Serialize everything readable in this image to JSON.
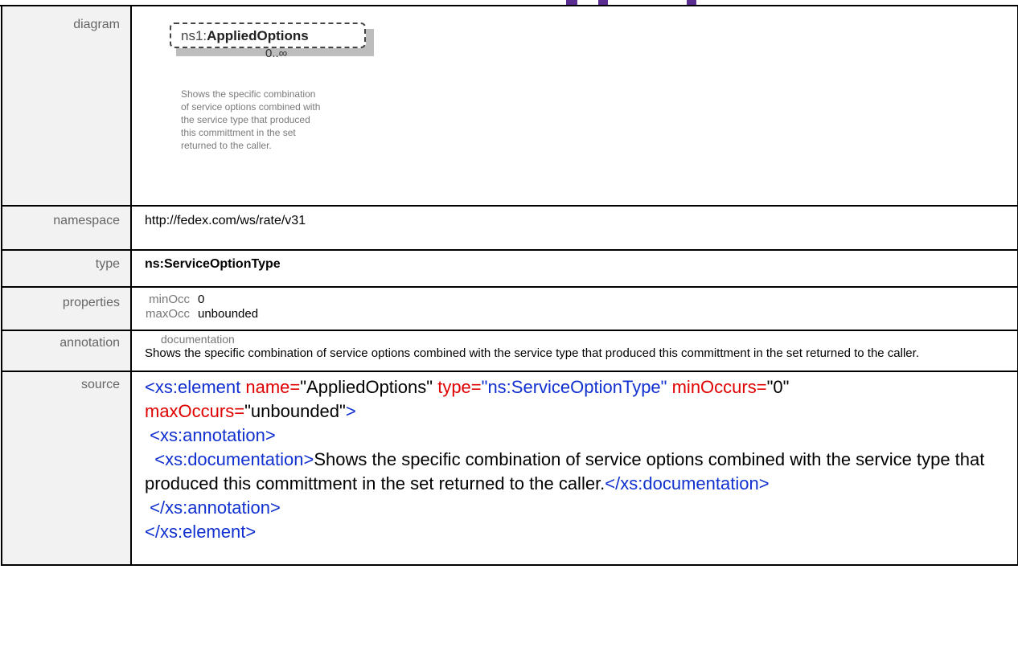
{
  "labels": {
    "diagram": "diagram",
    "namespace": "namespace",
    "type": "type",
    "properties": "properties",
    "annotation": "annotation",
    "source": "source"
  },
  "diagram": {
    "prefix": "ns1:",
    "element_name": "AppliedOptions",
    "occurrence": "0..∞",
    "note": "Shows the specific combination of service options combined with the service type that produced this committment in the set returned to the caller."
  },
  "namespace": "http://fedex.com/ws/rate/v31",
  "type": "ns:ServiceOptionType",
  "properties": [
    {
      "key": "minOcc",
      "value": "0"
    },
    {
      "key": "maxOcc",
      "value": "unbounded"
    }
  ],
  "annotation": {
    "key": "documentation",
    "text": "Shows the specific combination of service options combined with the service type that produced this committment in the set returned to the caller."
  },
  "source": {
    "open_tag": "<xs:element",
    "attr1_name": "name=",
    "attr1_value": "\"AppliedOptions\"",
    "attr2_name": "type=",
    "attr2_value": "\"ns:ServiceOptionType\"",
    "attr3_name": "minOccurs=",
    "attr3_value": "\"0\"",
    "attr4_name": "maxOccurs=",
    "attr4_value": "\"unbounded\"",
    "close_bracket": ">",
    "annotation_open": "<xs:annotation>",
    "documentation_open": "<xs:documentation>",
    "documentation_text": "Shows the specific combination of service options combined with the service type that produced this committment in the set returned to the caller.",
    "documentation_close": "</xs:documentation>",
    "annotation_close": "</xs:annotation>",
    "element_close": "</xs:element>"
  },
  "colors": {
    "bracket": "#1030d0",
    "element_name": "#8b0000",
    "attribute_name": "#e00000",
    "label_bg": "#f2f2f2",
    "accent": "#5b2d90"
  }
}
